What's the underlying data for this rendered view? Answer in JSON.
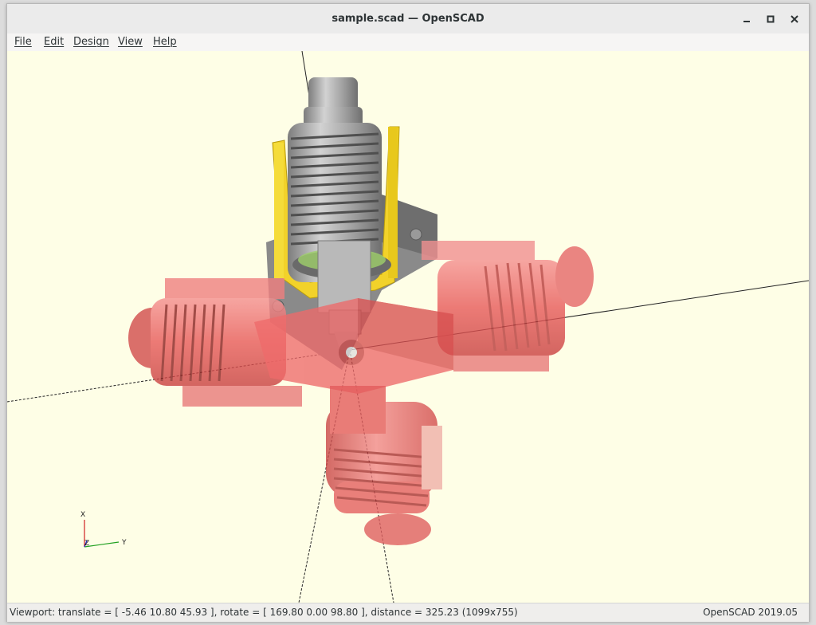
{
  "window": {
    "title": "sample.scad — OpenSCAD",
    "controls": {
      "minimize_icon": "minimize-icon",
      "maximize_icon": "maximize-icon",
      "close_icon": "close-icon"
    }
  },
  "menubar": {
    "items": [
      {
        "label": "File"
      },
      {
        "label": "Edit"
      },
      {
        "label": "Design"
      },
      {
        "label": "View"
      },
      {
        "label": "Help"
      }
    ]
  },
  "viewport": {
    "background": "#fefee6",
    "axes_gizmo": {
      "x_label": "X",
      "y_label": "Y",
      "z_label": "Z"
    },
    "colors": {
      "highlight_red": "#f06a6a",
      "bracket_yellow": "#f2d22a",
      "model_gray": "#a9a9a9"
    }
  },
  "statusbar": {
    "viewport_info": "Viewport: translate = [ -5.46 10.80 45.93 ], rotate = [ 169.80 0.00 98.80 ], distance = 325.23 (1099x755)",
    "version": "OpenSCAD 2019.05"
  }
}
